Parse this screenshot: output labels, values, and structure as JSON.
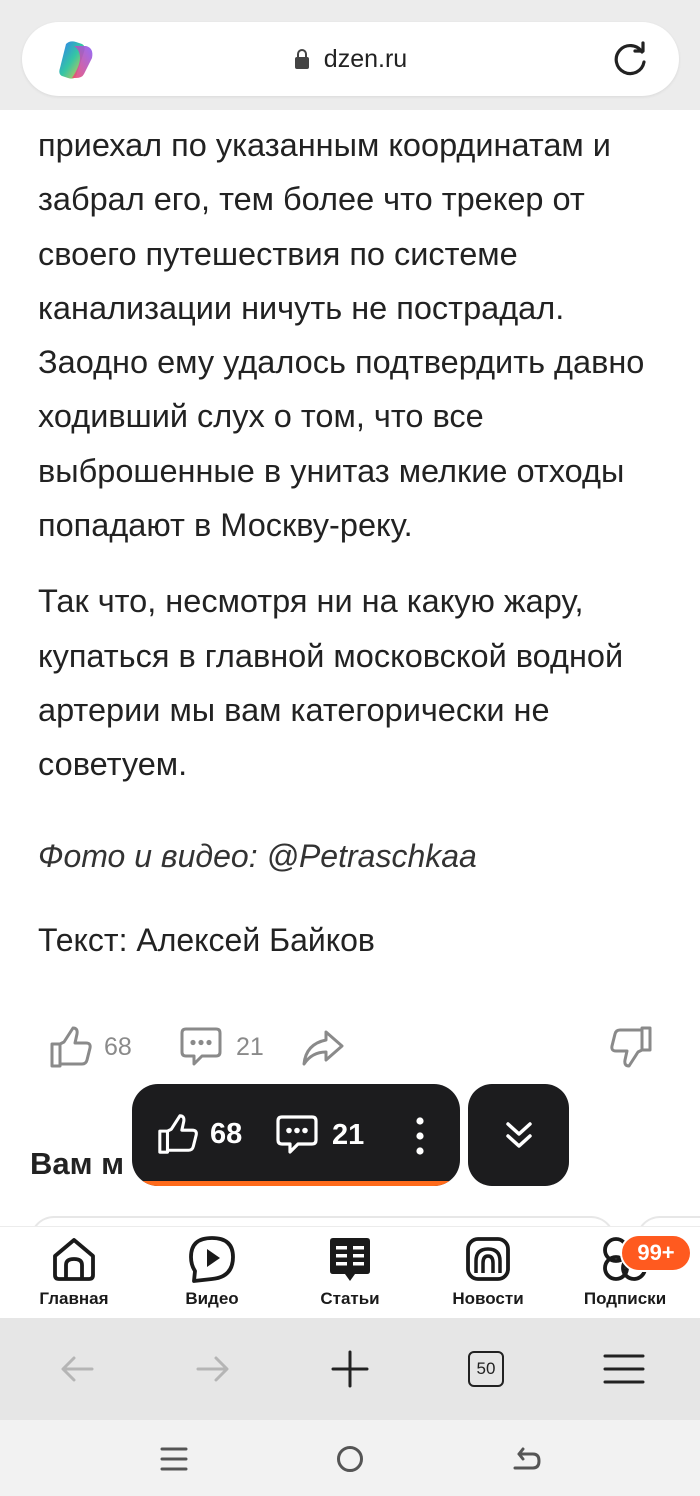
{
  "browser": {
    "domain": "dzen.ru",
    "tab_count": "50"
  },
  "article": {
    "paragraphs": [
      "приехал по указанным координатам и забрал его, тем более что трекер от своего путешествия по системе канализации ничуть не пострадал. Заодно ему удалось подтвердить давно ходивший слух о том, что все выброшенные в унитаз мелкие отходы попадают в Москву-реку.",
      "Так что, несмотря ни на какую жару, купаться в главной московской водной артерии мы вам категорически не советуем."
    ],
    "photo_credit": "Фото и видео: @Petraschkaa",
    "text_credit": "Текст: Алексей Байков"
  },
  "reactions": {
    "likes": "68",
    "comments": "21"
  },
  "floating_bar": {
    "likes": "68",
    "comments": "21"
  },
  "section_title": "Вам м",
  "zen_nav": {
    "items": [
      {
        "label": "Главная",
        "icon": "home-icon"
      },
      {
        "label": "Видео",
        "icon": "video-icon"
      },
      {
        "label": "Статьи",
        "icon": "articles-icon"
      },
      {
        "label": "Новости",
        "icon": "news-icon"
      },
      {
        "label": "Подписки",
        "icon": "subscriptions-icon"
      }
    ],
    "subscriptions_badge": "99+"
  },
  "colors": {
    "accent": "#ff5a1f",
    "floating_bg": "#1c1c1e"
  }
}
